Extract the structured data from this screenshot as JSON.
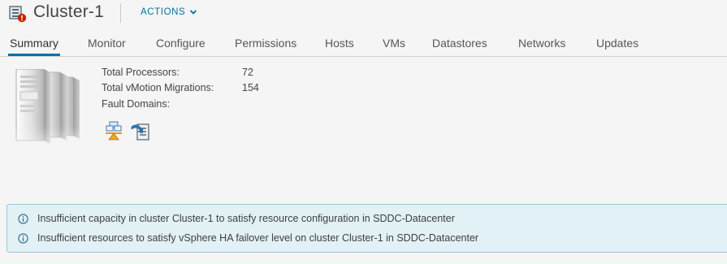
{
  "header": {
    "title": "Cluster-1",
    "actions_label": "ACTIONS",
    "title_icon": "cluster-alert-icon",
    "actions_icon": "chevron-down-icon"
  },
  "tabs": [
    {
      "label": "Summary",
      "active": true
    },
    {
      "label": "Monitor"
    },
    {
      "label": "Configure"
    },
    {
      "label": "Permissions"
    },
    {
      "label": "Hosts"
    },
    {
      "label": "VMs"
    },
    {
      "label": "Datastores"
    },
    {
      "label": "Networks"
    },
    {
      "label": "Updates"
    }
  ],
  "summary": {
    "image_icon": "server-cluster-image",
    "properties": [
      {
        "label": "Total Processors:",
        "value": "72"
      },
      {
        "label": "Total vMotion Migrations:",
        "value": "154"
      },
      {
        "label": "Fault Domains:",
        "value": ""
      }
    ],
    "fault_domain_icons": [
      "fault-domain-icon",
      "migrate-icon"
    ]
  },
  "alerts": [
    {
      "icon": "info-icon",
      "text": "Insufficient capacity in cluster Cluster-1 to satisfy resource configuration in SDDC-Datacenter"
    },
    {
      "icon": "info-icon",
      "text": "Insufficient resources to satisfy vSphere HA failover level on cluster Cluster-1 in SDDC-Datacenter"
    }
  ],
  "colors": {
    "accent": "#0072a3",
    "alert_bg": "#e1f1f6",
    "alert_border": "#9ac7d9",
    "error_badge": "#c92100"
  }
}
